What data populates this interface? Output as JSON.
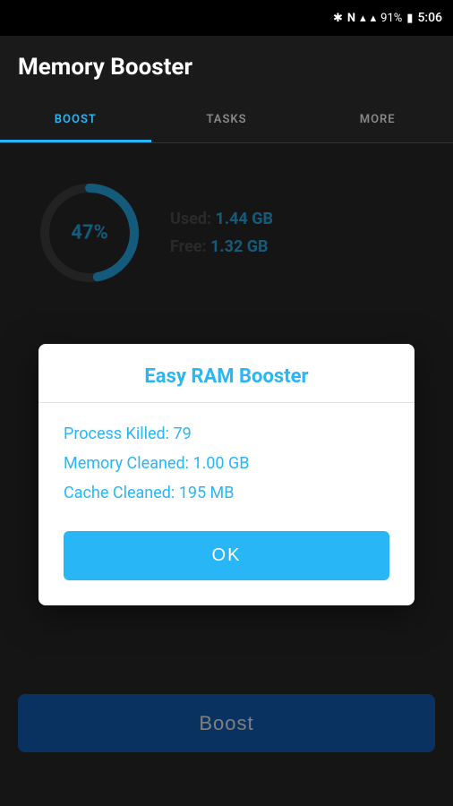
{
  "statusBar": {
    "battery": "91%",
    "time": "5:06"
  },
  "header": {
    "title": "Memory Booster"
  },
  "tabs": [
    {
      "id": "boost",
      "label": "BOOST",
      "active": true
    },
    {
      "id": "tasks",
      "label": "TASKS",
      "active": false
    },
    {
      "id": "more",
      "label": "MORE",
      "active": false
    }
  ],
  "memoryCard": {
    "percent": "47%",
    "usedLabel": "Used:",
    "usedValue": "1.44 GB",
    "freeLabel": "Free:",
    "freeValue": "1.32 GB"
  },
  "boostButton": {
    "label": "Boost"
  },
  "dialog": {
    "title": "Easy RAM Booster",
    "stats": [
      "Process Killed: 79",
      "Memory Cleaned: 1.00 GB",
      "Cache Cleaned: 195 MB"
    ],
    "okLabel": "OK"
  }
}
